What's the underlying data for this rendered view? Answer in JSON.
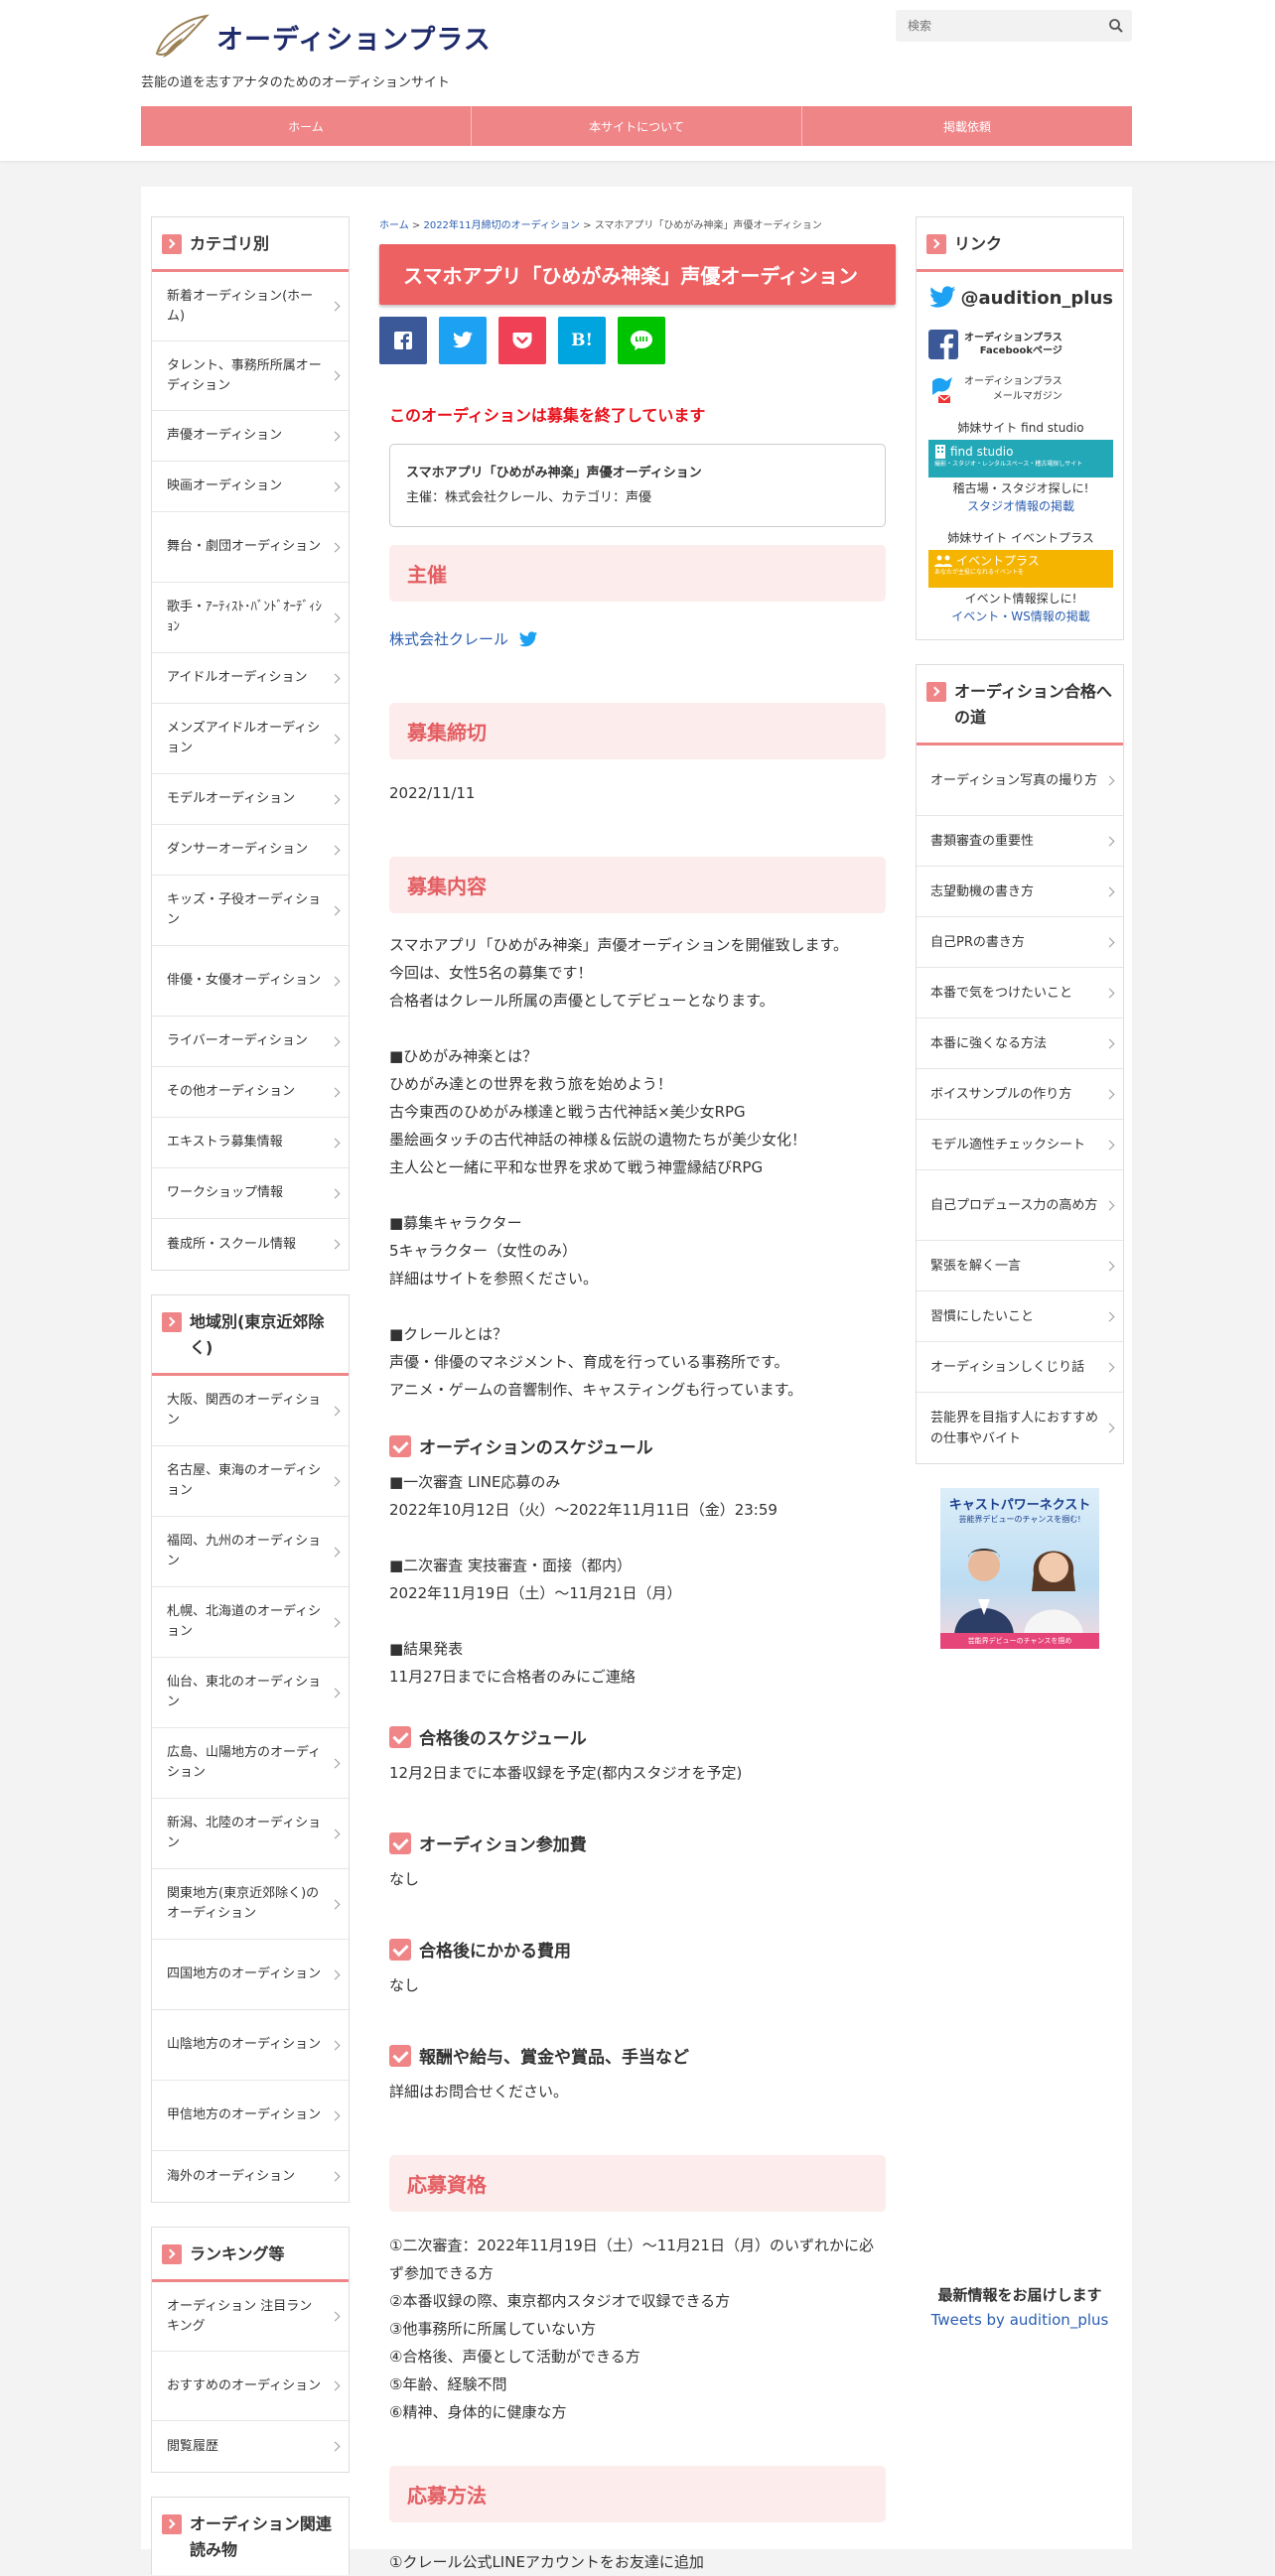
{
  "site": {
    "logo_text": "オーディションプラス",
    "tagline": "芸能の道を志すアナタのためのオーディションサイト",
    "search_placeholder": "検索"
  },
  "nav": [
    "ホーム",
    "本サイトについて",
    "掲載依頼"
  ],
  "left_sidebar": {
    "category": {
      "title": "カテゴリ別",
      "items": [
        "新着オーディション(ホーム)",
        "タレント、事務所所属オーディション",
        "声優オーディション",
        "映画オーディション",
        "舞台・劇団オーディション",
        "歌手・ｱｰﾃｨｽﾄ･ﾊﾞﾝﾄﾞｵｰﾃﾞｨｼｮﾝ",
        "アイドルオーディション",
        "メンズアイドルオーディション",
        "モデルオーディション",
        "ダンサーオーディション",
        "キッズ・子役オーディション",
        "俳優・女優オーディション",
        "ライバーオーディション",
        "その他オーディション",
        "エキストラ募集情報",
        "ワークショップ情報",
        "養成所・スクール情報"
      ]
    },
    "region": {
      "title": "地域別(東京近郊除く)",
      "items": [
        "大阪、関西のオーディション",
        "名古屋、東海のオーディション",
        "福岡、九州のオーディション",
        "札幌、北海道のオーディション",
        "仙台、東北のオーディション",
        "広島、山陽地方のオーディション",
        "新潟、北陸のオーディション",
        "関東地方(東京近郊除く)のオーディション",
        "四国地方のオーディション",
        "山陰地方のオーディション",
        "甲信地方のオーディション",
        "海外のオーディション"
      ]
    },
    "ranking": {
      "title": "ランキング等",
      "items": [
        "オーディション 注目ランキング",
        "おすすめのオーディション",
        "閲覧履歴"
      ]
    },
    "related": {
      "title": "オーディション関連読み物"
    }
  },
  "breadcrumb": {
    "home": "ホーム",
    "sep": ">",
    "category": "2022年11月締切のオーディション",
    "current": "スマホアプリ「ひめがみ神楽」声優オーディション"
  },
  "article": {
    "title": "スマホアプリ「ひめがみ神楽」声優オーディション",
    "share": [
      "f",
      "t",
      "p",
      "B!",
      "LINE"
    ],
    "closed_notice": "このオーディションは募集を終了しています",
    "info_title": "スマホアプリ「ひめがみ神楽」声優オーディション",
    "info_sub": "主催：株式会社クレール、カテゴリ：声優",
    "h_organizer": "主催",
    "organizer_link": "株式会社クレール",
    "h_deadline": "募集締切",
    "deadline": "2022/11/11",
    "h_content": "募集内容",
    "content_lines": [
      "スマホアプリ「ひめがみ神楽」声優オーディションを開催致します。",
      "今回は、女性5名の募集です！",
      "合格者はクレール所属の声優としてデビューとなります。",
      "",
      "■ひめがみ神楽とは？",
      "ひめがみ達との世界を救う旅を始めよう！",
      "古今東西のひめがみ様達と戦う古代神話×美少女RPG",
      "墨絵画タッチの古代神話の神様＆伝説の遺物たちが美少女化！",
      "主人公と一緒に平和な世界を求めて戦う神霊縁結びRPG",
      "",
      "■募集キャラクター",
      "5キャラクター（女性のみ）",
      "詳細はサイトを参照ください。",
      "",
      "■クレールとは？",
      "声優・俳優のマネジメント、育成を行っている事務所です。",
      "アニメ・ゲームの音響制作、キャスティングも行っています。"
    ],
    "h_schedule": "オーディションのスケジュール",
    "schedule_lines": [
      "■一次審査 LINE応募のみ",
      "2022年10月12日（火）～2022年11月11日（金）23:59",
      "",
      "■二次審査 実技審査・面接（都内）",
      "2022年11月19日（土）～11月21日（月）",
      "",
      "■結果発表",
      "11月27日までに合格者のみにご連絡"
    ],
    "h_after": "合格後のスケジュール",
    "after_text": "12月2日までに本番収録を予定(都内スタジオを予定)",
    "h_fee": "オーディション参加費",
    "fee_text": "なし",
    "h_cost": "合格後にかかる費用",
    "cost_text": "なし",
    "h_reward": "報酬や給与、賞金や賞品、手当など",
    "reward_text": "詳細はお問合せください。",
    "h_qualify": "応募資格",
    "qualify_lines": [
      "①二次審査：2022年11月19日（土）～11月21日（月）のいずれかに必ず参加できる方",
      "②本番収録の際、東京都内スタジオで収録できる方",
      "③他事務所に所属していない方",
      "④合格後、声優として活動ができる方",
      "⑤年齢、経験不問",
      "⑥精神、身体的に健康な方"
    ],
    "h_method": "応募方法",
    "method_partial": "①クレール公式LINEアカウントをお友達に追加"
  },
  "right_sidebar": {
    "links": {
      "title": "リンク",
      "twitter": "@audition_plus",
      "fb_line1": "オーディションプラス",
      "fb_line2": "Facebookページ",
      "ml_line1": "オーディションプラス",
      "ml_line2": "メールマガジン",
      "sister1_label": "姉妹サイト find studio",
      "fs_title": "find studio",
      "fs_sub": "撮影・スタジオ・レンタルスペース・稽古場探しサイト",
      "sister1_text": "稽古場・スタジオ探しに!",
      "sister1_link": "スタジオ情報の掲載",
      "sister2_label": "姉妹サイト イベントプラス",
      "ep_title": "イベントプラス",
      "ep_sub": "あなたが主役になれるイベントを",
      "sister2_text": "イベント情報探しに!",
      "sister2_link": "イベント・WS情報の掲載"
    },
    "road": {
      "title": "オーディション合格への道",
      "items": [
        "オーディション写真の撮り方",
        "書類審査の重要性",
        "志望動機の書き方",
        "自己PRの書き方",
        "本番で気をつけたいこと",
        "本番に強くなる方法",
        "ボイスサンプルの作り方",
        "モデル適性チェックシート",
        "自己プロデュース力の高め方",
        "緊張を解く一言",
        "習慣にしたいこと",
        "オーディションしくじり話",
        "芸能界を目指す人におすすめの仕事やバイト"
      ]
    },
    "ad": {
      "title": "キャストパワーネクスト",
      "sub": "芸能界デビューのチャンスを掴む!",
      "bottom": "芸能界デビューのチャンスを掴め"
    },
    "tweets": {
      "title": "最新情報をお届けします",
      "link": "Tweets by audition_plus"
    }
  },
  "colors": {
    "accent": "#f08588",
    "title_red": "#ee6162",
    "closed_red": "#e8101a",
    "heading_bg": "#fdecec"
  }
}
